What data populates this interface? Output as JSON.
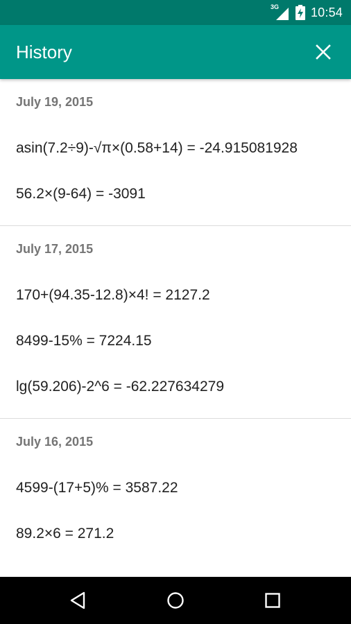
{
  "status_bar": {
    "network": "3G",
    "time": "10:54"
  },
  "app_bar": {
    "title": "History",
    "close_icon": "close-icon"
  },
  "history": {
    "groups": [
      {
        "date": "July 19, 2015",
        "entries": [
          "asin(7.2÷9)-√π×(0.58+14) = -24.915081928",
          "56.2×(9-64) = -3091"
        ]
      },
      {
        "date": "July 17, 2015",
        "entries": [
          "170+(94.35-12.8)×4! = 2127.2",
          "8499-15% = 7224.15",
          "lg(59.206)-2^6 = -62.227634279"
        ]
      },
      {
        "date": "July 16, 2015",
        "entries": [
          "4599-(17+5)% = 3587.22",
          "89.2×6 = 271.2"
        ]
      }
    ]
  },
  "nav_bar": {
    "icons": [
      "back-icon",
      "home-icon",
      "recents-icon"
    ]
  },
  "colors": {
    "status_bar": "#00796b",
    "app_bar": "#009688",
    "date_text": "#757575",
    "entry_text": "#212121",
    "divider": "#dcdcdc",
    "nav_bar": "#000000"
  }
}
